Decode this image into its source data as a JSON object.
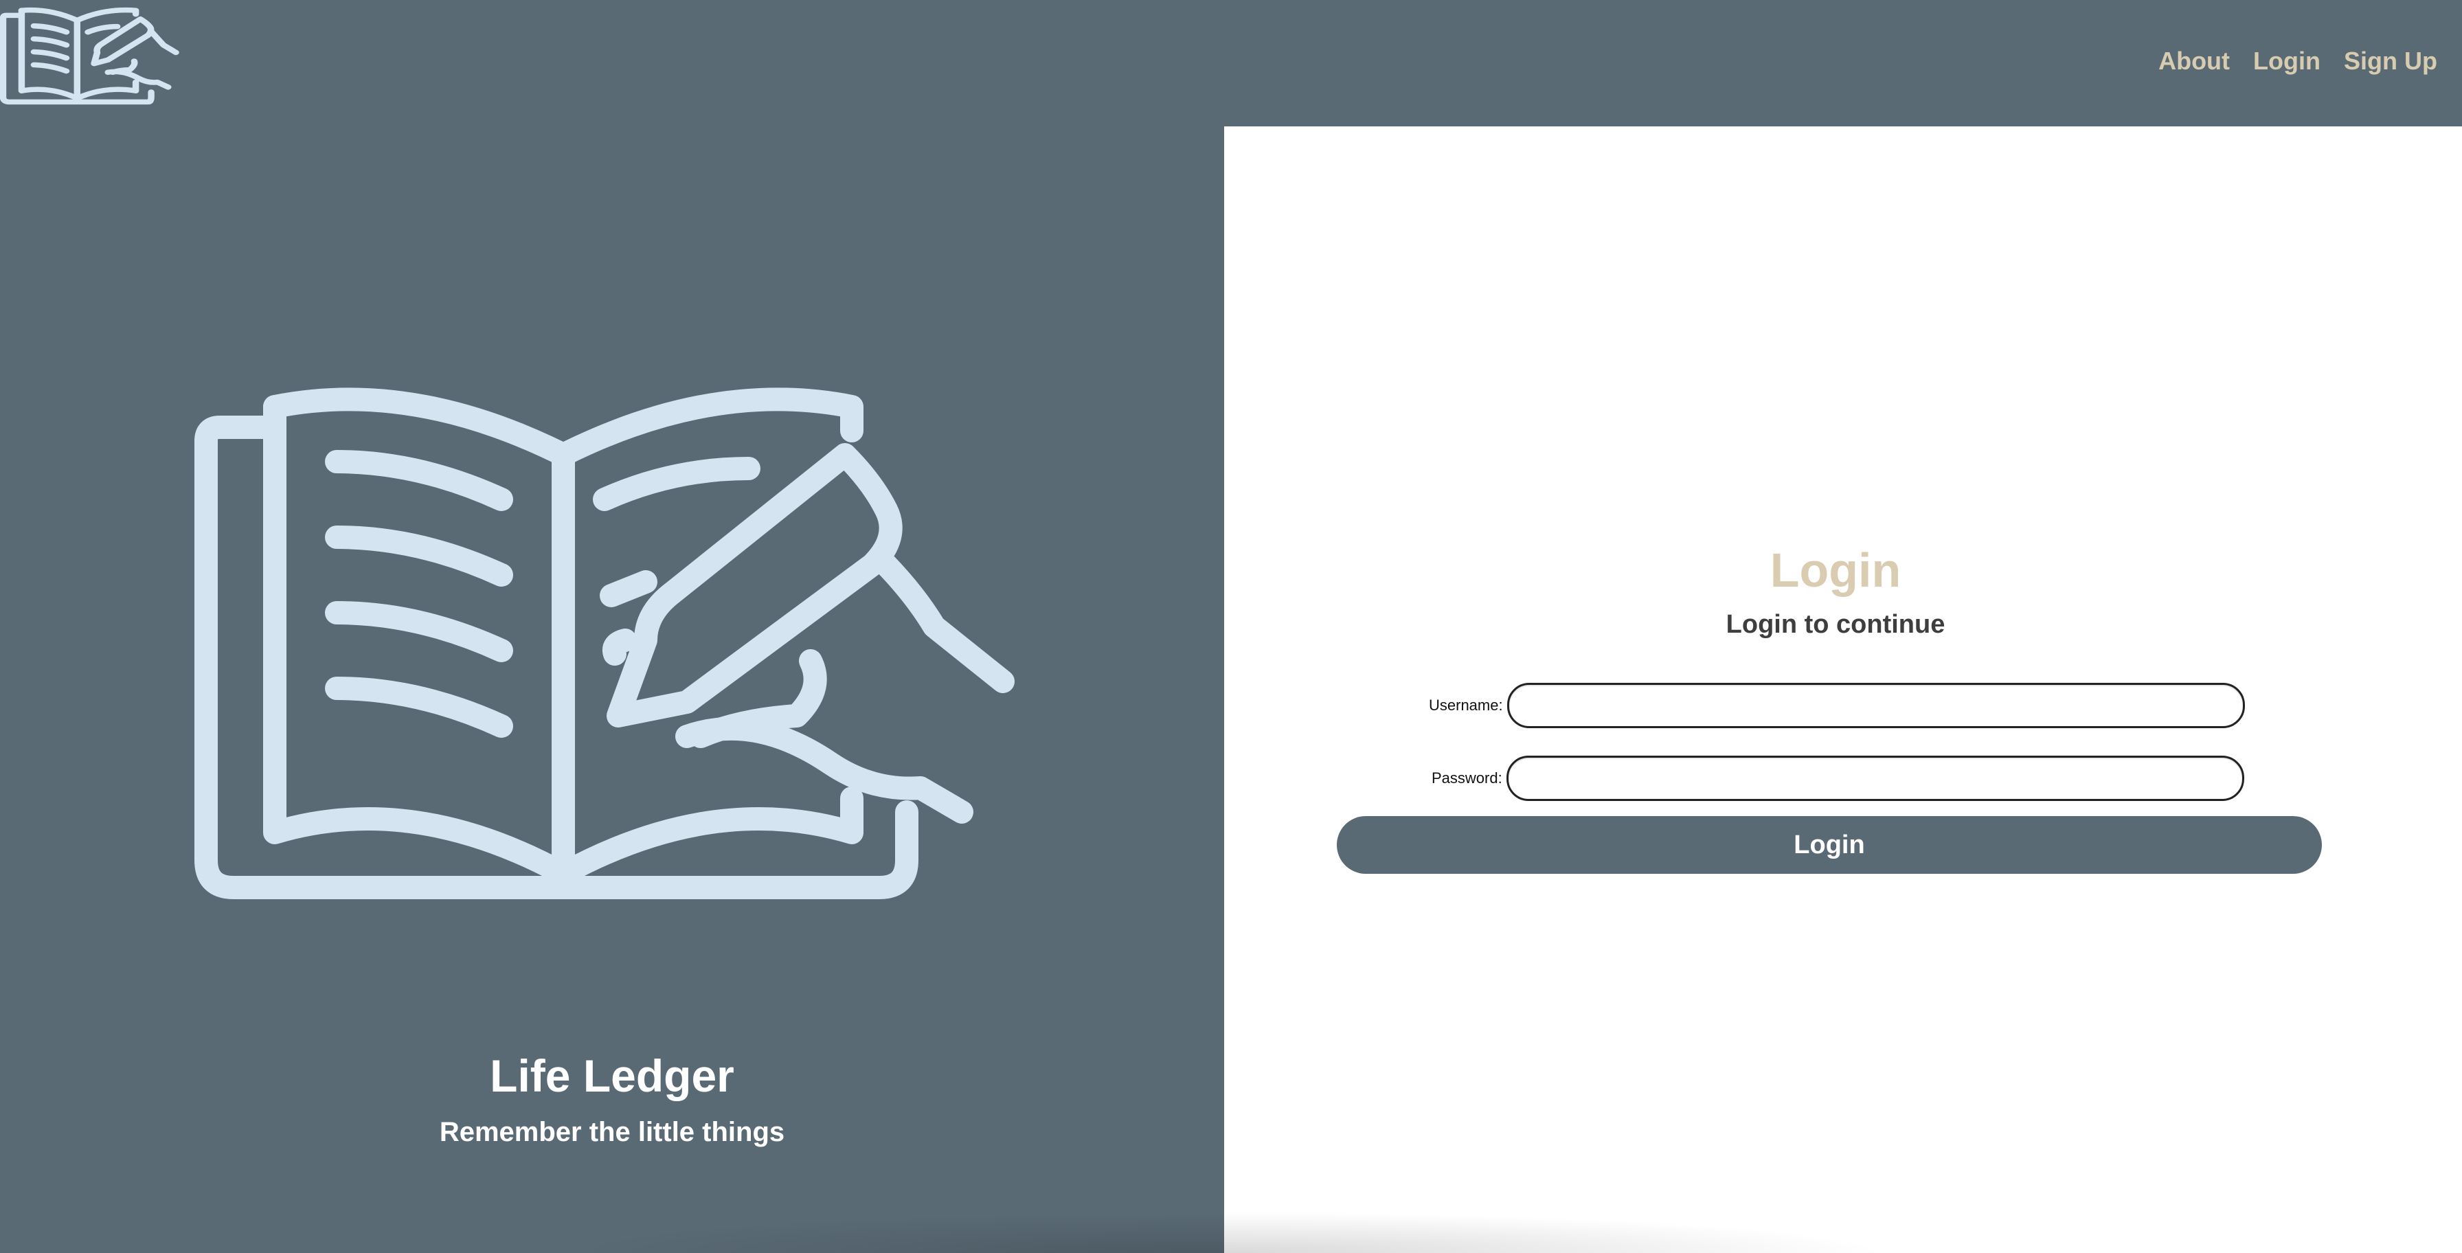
{
  "app": {
    "logo_icon": "open-book-with-pen-icon"
  },
  "nav": {
    "items": [
      {
        "label": "About"
      },
      {
        "label": "Login"
      },
      {
        "label": "Sign Up"
      }
    ]
  },
  "hero": {
    "icon": "open-book-with-pen-icon",
    "title": "Life Ledger",
    "subtitle": "Remember the little things"
  },
  "login": {
    "heading": "Login",
    "subheading": "Login to continue",
    "username_label": "Username:",
    "password_label": "Password:",
    "button_label": "Login"
  },
  "colors": {
    "background": "#5a6a75",
    "accent": "#d8ccb0",
    "icon": "#d4e4f0",
    "panel": "#ffffff"
  }
}
